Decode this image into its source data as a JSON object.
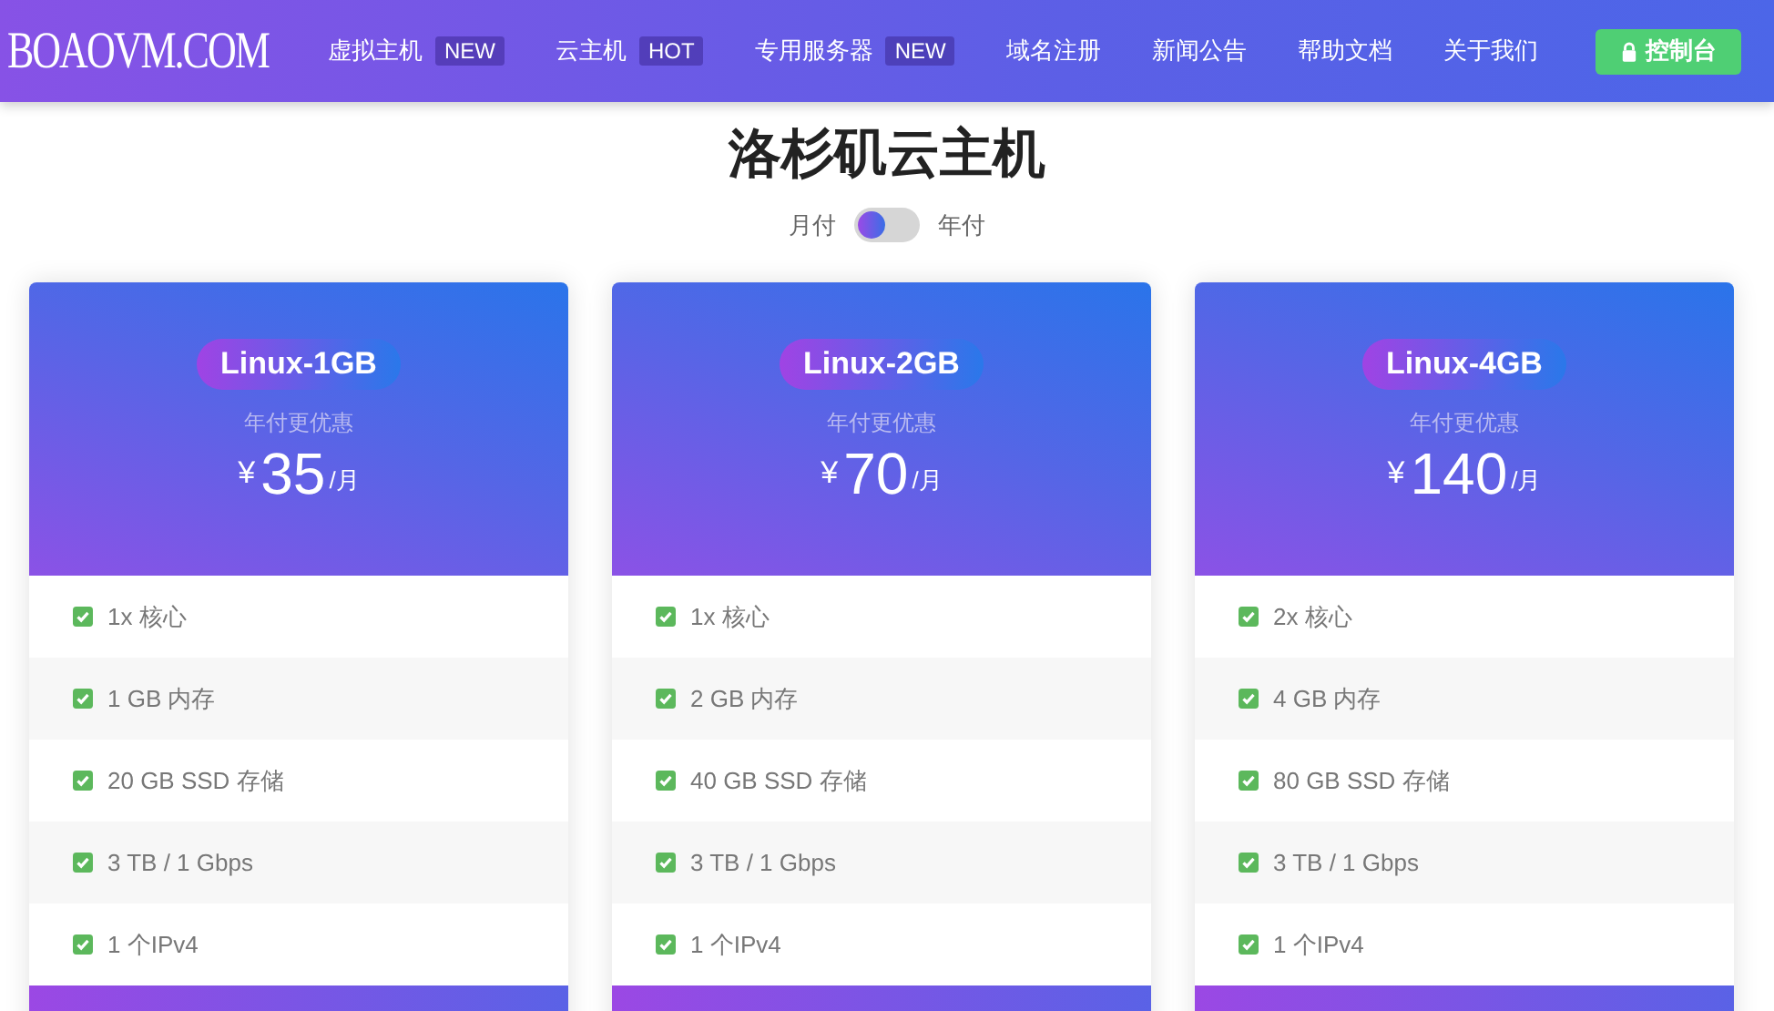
{
  "nav": {
    "logo": "BOAOVM.COM",
    "items": [
      {
        "label": "虚拟主机",
        "badge": "NEW"
      },
      {
        "label": "云主机",
        "badge": "HOT"
      },
      {
        "label": "专用服务器",
        "badge": "NEW"
      },
      {
        "label": "域名注册"
      },
      {
        "label": "新闻公告"
      },
      {
        "label": "帮助文档"
      },
      {
        "label": "关于我们"
      }
    ],
    "console_button": "控制台"
  },
  "title": "洛杉矶云主机",
  "billing_toggle": {
    "left_label": "月付",
    "right_label": "年付",
    "on": false
  },
  "plans": [
    {
      "name": "Linux-1GB",
      "note": "年付更优惠",
      "currency": "¥",
      "price": "35",
      "unit": "/月",
      "features": [
        "1x 核心",
        "1 GB 内存",
        "20 GB SSD 存储",
        "3 TB / 1 Gbps",
        "1 个IPv4"
      ]
    },
    {
      "name": "Linux-2GB",
      "note": "年付更优惠",
      "currency": "¥",
      "price": "70",
      "unit": "/月",
      "features": [
        "1x 核心",
        "2 GB 内存",
        "40 GB SSD 存储",
        "3 TB / 1 Gbps",
        "1 个IPv4"
      ]
    },
    {
      "name": "Linux-4GB",
      "note": "年付更优惠",
      "currency": "¥",
      "price": "140",
      "unit": "/月",
      "features": [
        "2x 核心",
        "4 GB 内存",
        "80 GB SSD 存储",
        "3 TB / 1 Gbps",
        "1 个IPv4"
      ]
    }
  ]
}
